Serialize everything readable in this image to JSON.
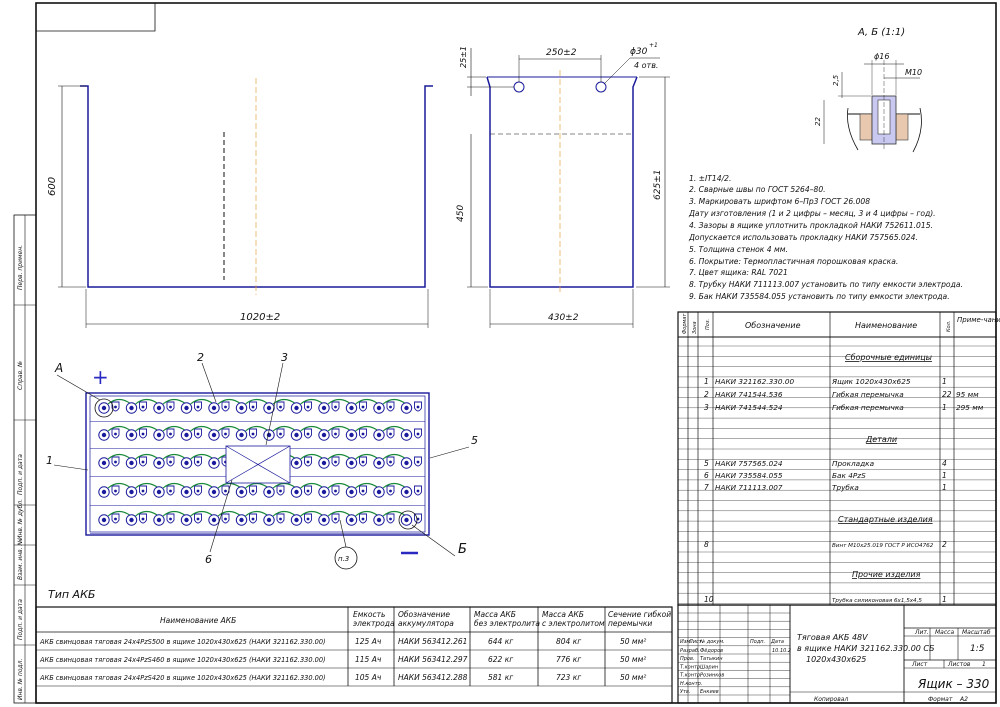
{
  "section_label": "А, Б (1:1)",
  "dims": {
    "width_front": "1020±2",
    "height_front": "600",
    "width_side": "430±2",
    "height_side_inner": "450",
    "height_side_total": "625±1",
    "hole_spacing": "250±2",
    "hole_top": "25±1",
    "hole_dia": "ϕ30",
    "hole_dia_sup": "+1",
    "hole_count": "4 отв.",
    "detail_d16": "ϕ16",
    "detail_m10": "М10",
    "detail_25": "2,5",
    "detail_22": "22"
  },
  "notes": [
    "1. ±IT14/2.",
    "2. Сварные швы по ГОСТ 5264–80.",
    "3. Маркировать шрифтом 6–Пр3 ГОСТ 26.008",
    "Дату изготовления (1 и 2 цифры – месяц, 3 и 4 цифры – год).",
    "4. Зазоры в ящике уплотнить прокладкой НАКИ 752611.015.",
    "Допускается использовать прокладку НАКИ 757565.024.",
    "5. Толщина стенок 4 мм.",
    "6. Покрытие: Термопластичная порошковая краска.",
    "7. Цвет ящика: RAL 7021",
    "8. Трубку НАКИ 711113.007 установить по типу емкости электрода.",
    "9. Бак НАКИ 735584.055 установить по типу емкости электрода."
  ],
  "callouts": {
    "c1": "1",
    "c2": "2",
    "c3": "3",
    "c5": "5",
    "c6": "6",
    "A": "А",
    "B": "Б",
    "p3": "п.3",
    "plus": "+",
    "minus": "–"
  },
  "spec": {
    "headers": {
      "format": "Формат",
      "zone": "Зона",
      "pos": "Поз.",
      "designation": "Обозначение",
      "name": "Наименование",
      "qty": "Кол.",
      "note": "Приме-чание"
    },
    "sections": {
      "assembly": "Сборочные единицы",
      "details": "Детали",
      "standard": "Стандартные изделия",
      "other": "Прочие изделия"
    },
    "rows": [
      {
        "pos": "1",
        "designation": "НАКИ 321162.330.00",
        "name": "Ящик 1020х430х625",
        "qty": "1",
        "note": ""
      },
      {
        "pos": "2",
        "designation": "НАКИ 741544.536",
        "name": "Гибкая перемычка",
        "qty": "22",
        "note": "95 мм"
      },
      {
        "pos": "3",
        "designation": "НАКИ 741544.524",
        "name": "Гибкая перемычка",
        "qty": "1",
        "note": "295 мм"
      },
      {
        "pos": "5",
        "designation": "НАКИ 757565.024",
        "name": "Прокладка",
        "qty": "4",
        "note": ""
      },
      {
        "pos": "6",
        "designation": "НАКИ 735584.055",
        "name": "Бак 4PzS",
        "qty": "1",
        "note": ""
      },
      {
        "pos": "7",
        "designation": "НАКИ 711113.007",
        "name": "Трубка",
        "qty": "1",
        "note": ""
      },
      {
        "pos": "8",
        "designation": "",
        "name": "Винт М10х25.019 ГОСТ Р ИСО4762",
        "qty": "2",
        "note": ""
      },
      {
        "pos": "10",
        "designation": "",
        "name": "Трубка силиконовая 6х1,5х4,5",
        "qty": "1",
        "note": ""
      }
    ]
  },
  "type_title": "Тип АКБ",
  "akb_table": {
    "headers": [
      "Наименование АКБ",
      "Емкость электрода",
      "Обозначение аккумулятора",
      "Масса АКБ без электролита",
      "Масса АКБ с электролитом",
      "Сечение гибкой перемычки"
    ],
    "rows": [
      [
        "АКБ свинцовая тяговая 24х4PzS500 в ящике 1020х430х625 (НАКИ 321162.330.00)",
        "125 Ач",
        "НАКИ 563412.261",
        "644 кг",
        "804 кг",
        "50 мм²"
      ],
      [
        "АКБ свинцовая тяговая 24х4PzS460 в ящике 1020х430х625 (НАКИ 321162.330.00)",
        "115 Ач",
        "НАКИ 563412.297",
        "622 кг",
        "776 кг",
        "50 мм²"
      ],
      [
        "АКБ свинцовая тяговая 24х4PzS420 в ящике 1020х430х625 (НАКИ 321162.330.00)",
        "105 Ач",
        "НАКИ 563412.288",
        "581 кг",
        "723 кг",
        "50 мм²"
      ]
    ]
  },
  "title_block": {
    "title": "Тяговая АКБ 48V в ящике НАКИ 321162.330.00 СБ 1020х430х625",
    "doc_name": "Ящик – 330",
    "lit": "Лит.",
    "mass": "Масса",
    "scale": "Масштаб",
    "scale_val": "1:5",
    "sheet": "Лист",
    "sheets": "Листов",
    "sheets_val": "1",
    "copied": "Копировал",
    "format": "Формат",
    "format_val": "А2",
    "date_val": "10.10.2",
    "roles": [
      "Изм.",
      "Лист",
      "№ докум.",
      "Подп.",
      "Дата"
    ],
    "people": [
      {
        "role": "Разраб.",
        "name": "Фёдоров"
      },
      {
        "role": "Пров.",
        "name": "Татыкин"
      },
      {
        "role": "Т.контр.",
        "name": "Шарин"
      },
      {
        "role": "Т.контр.",
        "name": "Розинков"
      },
      {
        "role": "Н.контр.",
        "name": ""
      },
      {
        "role": "Утв.",
        "name": "Енкиев"
      }
    ]
  },
  "side_strip": [
    "Перв. примен.",
    "Справ. №",
    "Подп. и дата",
    "Инв. № дубл.",
    "Взам. инв. №",
    "Подп. и дата",
    "Инв. № подл."
  ]
}
